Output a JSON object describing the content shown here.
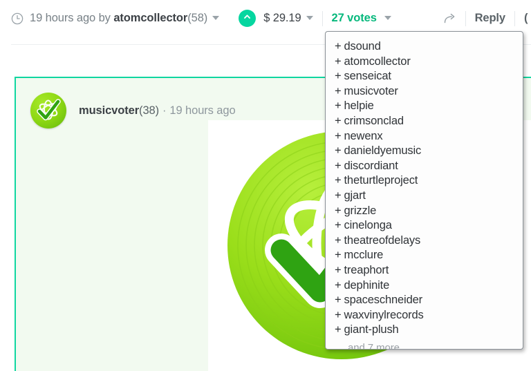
{
  "header": {
    "clock_icon": "clock-icon",
    "time_text": "19 hours ago by ",
    "author": "atomcollector",
    "author_rep": "(58)",
    "upvote_icon": "chevron-up-icon",
    "payout": "$ 29.19",
    "votes_label": "27 votes",
    "share_icon": "share-icon",
    "reply_label": "Reply",
    "edge_label": "("
  },
  "comment": {
    "avatar_icon": "musicvoter-check-atom-avatar",
    "username": "musicvoter",
    "reputation": "(38)",
    "separator": "·",
    "timestamp": "19 hours ago",
    "image_alt": "musicvoter-logo-image"
  },
  "votes_panel": {
    "voters": [
      "dsound",
      "atomcollector",
      "senseicat",
      "musicvoter",
      "helpie",
      "crimsonclad",
      "newenx",
      "danieldyemusic",
      "discordiant",
      "theturtleproject",
      "gjart",
      "grizzle",
      "cinelonga",
      "theatreofdelays",
      "mcclure",
      "treaphort",
      "dephinite",
      "spaceschneider",
      "waxvinylrecords",
      "giant-plush"
    ],
    "plus": "+",
    "more_label": "… and 7 more"
  },
  "colors": {
    "accent_green": "#06b87c",
    "upvote_teal": "#06d6a0",
    "card_border": "#0fd6a0",
    "card_bg": "#f2faf0",
    "meta_text": "#788187",
    "strong_text": "#3c4146"
  }
}
